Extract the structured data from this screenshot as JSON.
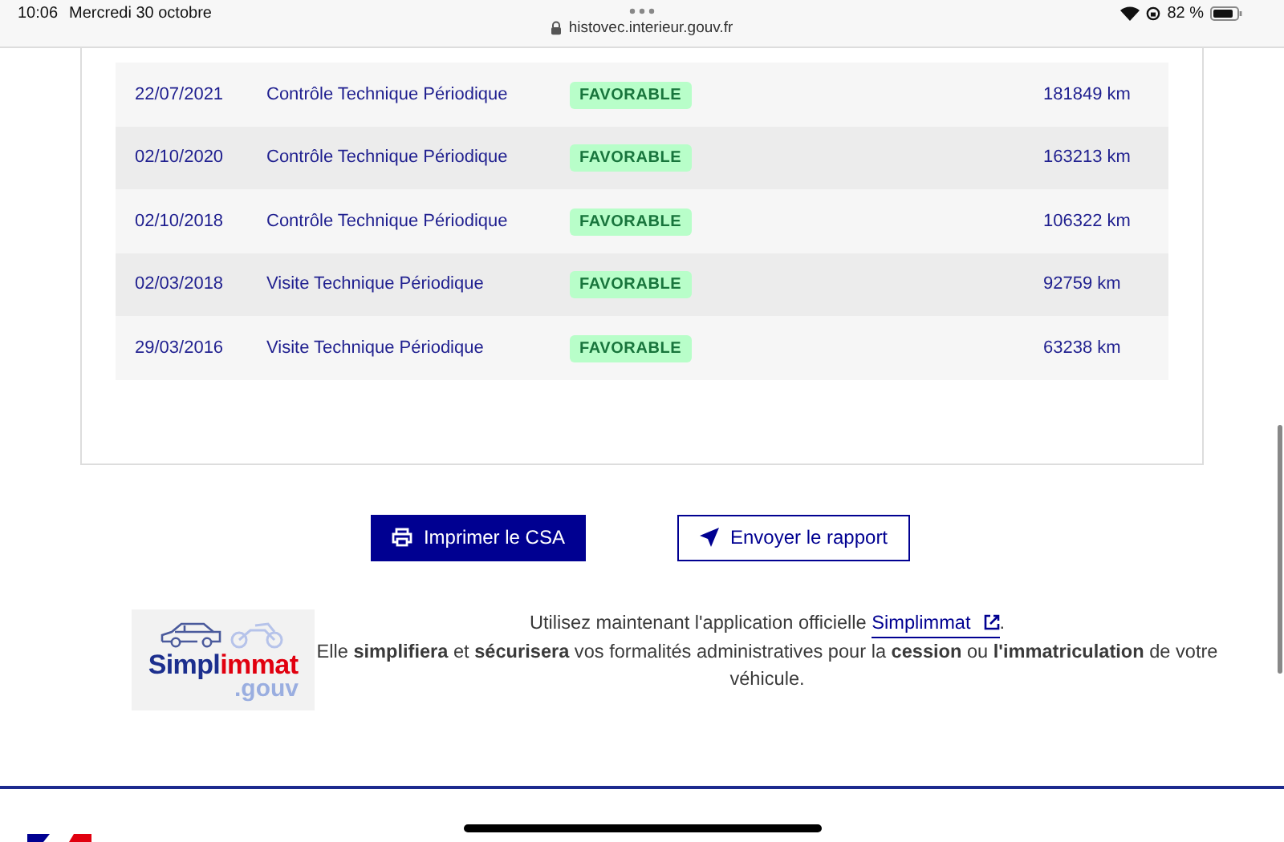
{
  "status_bar": {
    "time": "10:06",
    "date": "Mercredi 30 octobre",
    "url": "histovec.interieur.gouv.fr",
    "battery": "82 %"
  },
  "table": {
    "rows": [
      {
        "date": "22/07/2021",
        "type": "Contrôle Technique Périodique",
        "result": "FAVORABLE",
        "mileage": "181849 km"
      },
      {
        "date": "02/10/2020",
        "type": "Contrôle Technique Périodique",
        "result": "FAVORABLE",
        "mileage": "163213 km"
      },
      {
        "date": "02/10/2018",
        "type": "Contrôle Technique Périodique",
        "result": "FAVORABLE",
        "mileage": "106322 km"
      },
      {
        "date": "02/03/2018",
        "type": "Visite Technique Périodique",
        "result": "FAVORABLE",
        "mileage": "92759 km"
      },
      {
        "date": "29/03/2016",
        "type": "Visite Technique Périodique",
        "result": "FAVORABLE",
        "mileage": "63238 km"
      }
    ]
  },
  "actions": [
    {
      "label": "Imprimer le CSA",
      "kind": "primary"
    },
    {
      "label": "Envoyer le rapport",
      "kind": "secondary"
    }
  ],
  "promo": {
    "logo": {
      "part_1": "Simpl",
      "part_2": "immat",
      "domain": ".gouv"
    },
    "intro": "Utilisez maintenant l'application officielle ",
    "link": "Simplimmat",
    "after_link": ".",
    "body": "Elle **simplifiera** et **sécurisera** vos formalités administratives pour la **cession** ou **l'immatriculation** de votre véhicule."
  }
}
